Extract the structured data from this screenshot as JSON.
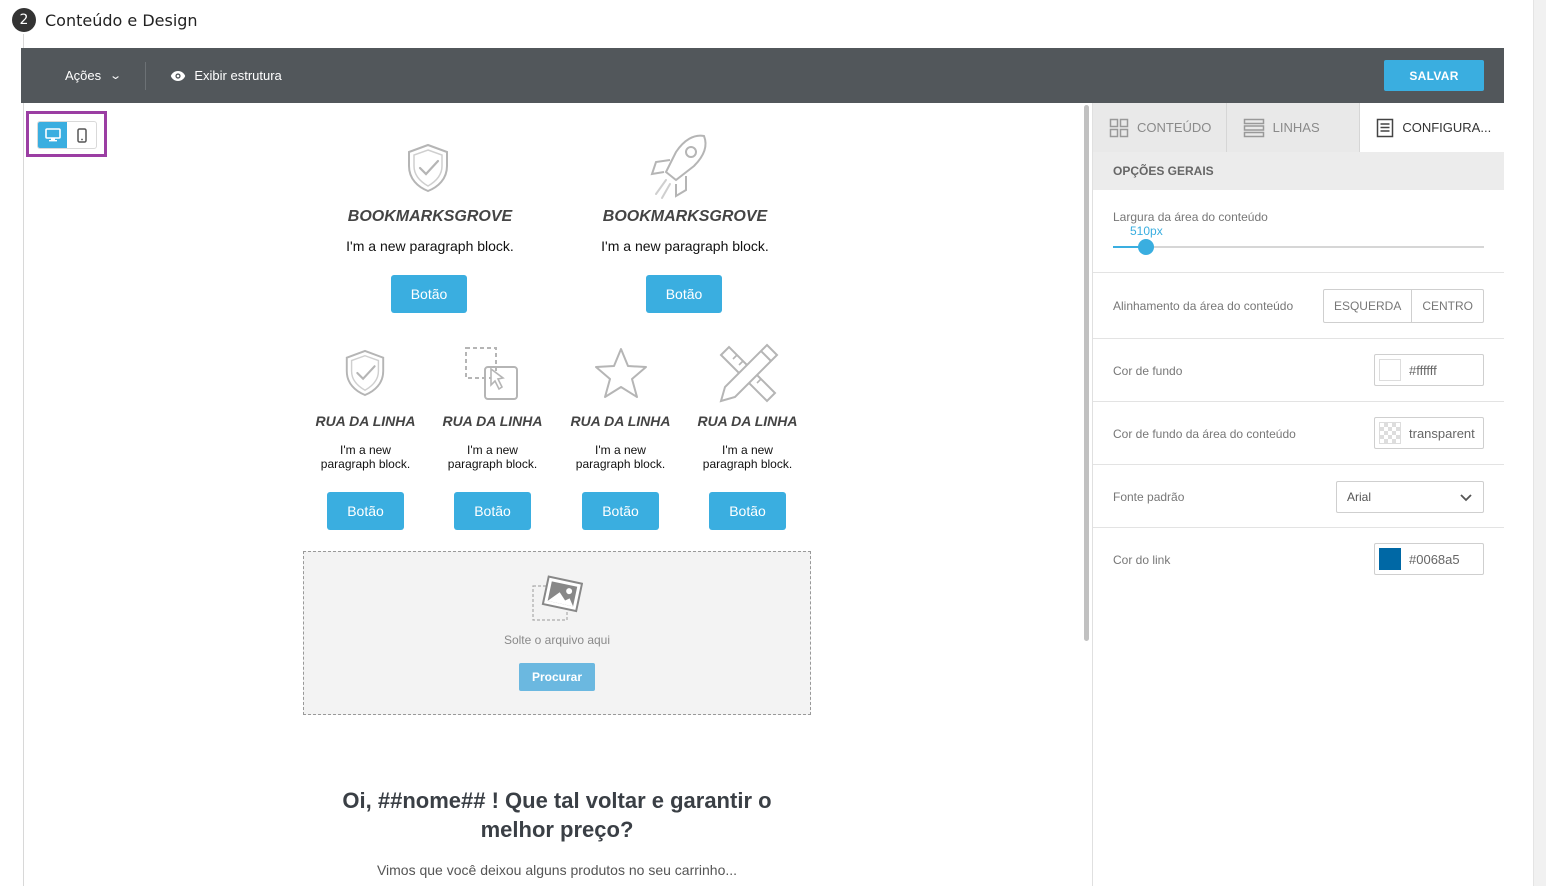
{
  "step": {
    "number": "2",
    "title": "Conteúdo e Design"
  },
  "toolbar": {
    "actions_label": "Ações",
    "structure_label": "Exibir estrutura",
    "save_label": "SALVAR"
  },
  "canvas": {
    "row1": [
      {
        "icon": "shield-check-icon",
        "title": "BOOKMARKSGROVE",
        "paragraph": "I'm a new paragraph block.",
        "button": "Botão"
      },
      {
        "icon": "rocket-icon",
        "title": "BOOKMARKSGROVE",
        "paragraph": "I'm a new paragraph block.",
        "button": "Botão"
      }
    ],
    "row2": [
      {
        "icon": "shield-check-icon",
        "title": "RUA DA LINHA",
        "para1": "I'm a new",
        "para2": "paragraph block.",
        "button": "Botão"
      },
      {
        "icon": "drag-drop-icon",
        "title": "RUA DA LINHA",
        "para1": "I'm a new",
        "para2": "paragraph block.",
        "button": "Botão"
      },
      {
        "icon": "star-icon",
        "title": "RUA DA LINHA",
        "para1": "I'm a new",
        "para2": "paragraph block.",
        "button": "Botão"
      },
      {
        "icon": "pencil-ruler-icon",
        "title": "RUA DA LINHA",
        "para1": "I'm a new",
        "para2": "paragraph block.",
        "button": "Botão"
      }
    ],
    "dropzone": {
      "text": "Solte o arquivo aqui",
      "button": "Procurar"
    },
    "headline": "Oi, ##nome## ! Que tal voltar e garantir o melhor preço?",
    "subline": "Vimos que você deixou alguns produtos no seu carrinho..."
  },
  "panel": {
    "tabs": [
      "CONTEÚDO",
      "LINHAS",
      "CONFIGURA..."
    ],
    "section": "OPÇÕES GERAIS",
    "width_label": "Largura da área do conteúdo",
    "width_value": "510px",
    "width_fraction": 0.09,
    "align_label": "Alinhamento da área do conteúdo",
    "align_options": [
      "ESQUERDA",
      "CENTRO"
    ],
    "bg_label": "Cor de fundo",
    "bg_value": "#ffffff",
    "content_bg_label": "Cor de fundo da área do conteúdo",
    "content_bg_value": "transparent",
    "font_label": "Fonte padrão",
    "font_value": "Arial",
    "link_label": "Cor do link",
    "link_value": "#0068a5"
  },
  "colors": {
    "accent": "#3aaee0",
    "toolbar": "#52575b",
    "highlight": "#9b3ea3"
  }
}
